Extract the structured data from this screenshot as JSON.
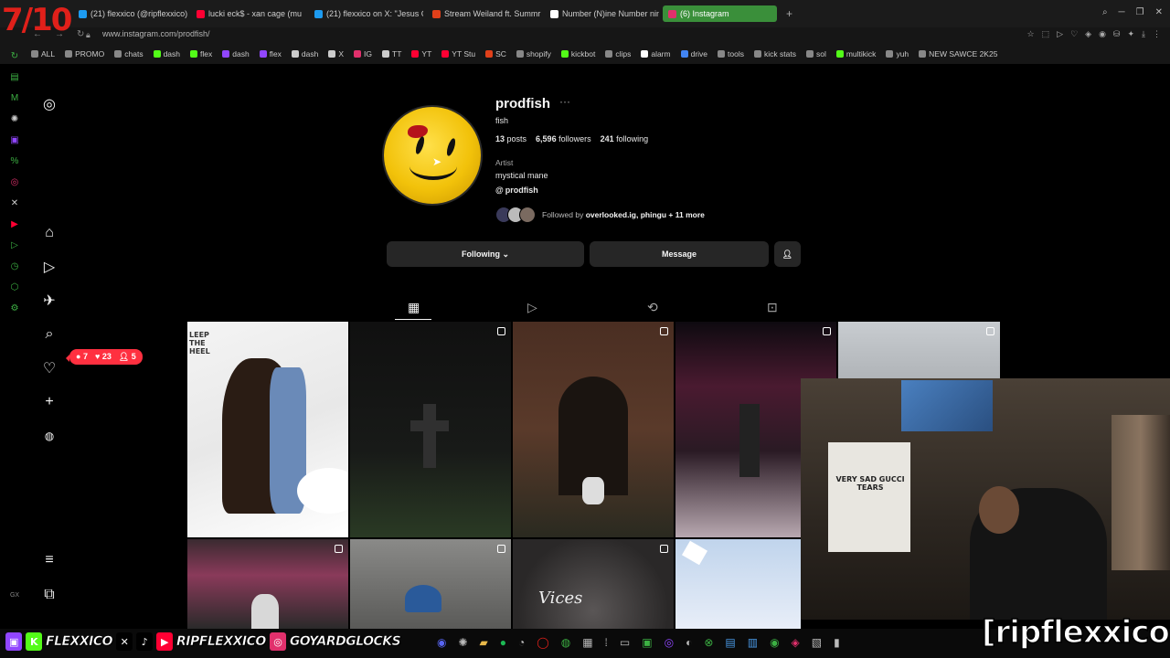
{
  "overlay": {
    "score": "7/10",
    "handle": "[ripflexxico]"
  },
  "browser": {
    "tabs": [
      {
        "title": "(21) flexxico (@ripflexxico)",
        "color": "#1d9bf0",
        "icon": "x-icon"
      },
      {
        "title": "lucki eck$ - xan cage (mu",
        "color": "#ff0033",
        "icon": "youtube-icon"
      },
      {
        "title": "(21) flexxico on X: \"Jesus C",
        "color": "#1d9bf0",
        "icon": "x-icon"
      },
      {
        "title": "Stream Weiland ft. Summr",
        "color": "#e0401a",
        "icon": "soundcloud-icon"
      },
      {
        "title": "Number (N)ine Number nin",
        "color": "#ffffff",
        "icon": "page-icon"
      },
      {
        "title": "(6) Instagram",
        "color": "#e1306c",
        "icon": "instagram-icon"
      }
    ],
    "new_tab": "+",
    "url": "www.instagram.com/prodfish/",
    "bookmarks": [
      {
        "label": "ALL",
        "icon": "folder-icon",
        "color": "#888"
      },
      {
        "label": "PROMO",
        "icon": "folder-icon",
        "color": "#888"
      },
      {
        "label": "chats",
        "icon": "folder-icon",
        "color": "#888"
      },
      {
        "label": "dash",
        "icon": "kick-icon",
        "color": "#53fc18"
      },
      {
        "label": "flex",
        "icon": "kick-icon",
        "color": "#53fc18"
      },
      {
        "label": "dash",
        "icon": "twitch-icon",
        "color": "#9146ff"
      },
      {
        "label": "flex",
        "icon": "twitch-icon",
        "color": "#9146ff"
      },
      {
        "label": "dash",
        "icon": "x-icon",
        "color": "#ccc"
      },
      {
        "label": "X",
        "icon": "x-icon",
        "color": "#ccc"
      },
      {
        "label": "IG",
        "icon": "instagram-icon",
        "color": "#e1306c"
      },
      {
        "label": "TT",
        "icon": "tiktok-icon",
        "color": "#ccc"
      },
      {
        "label": "YT",
        "icon": "youtube-icon",
        "color": "#ff0033"
      },
      {
        "label": "YT Stu",
        "icon": "youtube-icon",
        "color": "#ff0033"
      },
      {
        "label": "SC",
        "icon": "soundcloud-icon",
        "color": "#e0401a"
      },
      {
        "label": "shopify",
        "icon": "folder-icon",
        "color": "#888"
      },
      {
        "label": "kickbot",
        "icon": "bot-icon",
        "color": "#53fc18"
      },
      {
        "label": "clips",
        "icon": "folder-icon",
        "color": "#888"
      },
      {
        "label": "alarm",
        "icon": "alarm-icon",
        "color": "#fff"
      },
      {
        "label": "drive",
        "icon": "google-icon",
        "color": "#4285f4"
      },
      {
        "label": "tools",
        "icon": "folder-icon",
        "color": "#888"
      },
      {
        "label": "kick stats",
        "icon": "folder-icon",
        "color": "#888"
      },
      {
        "label": "sol",
        "icon": "folder-icon",
        "color": "#888"
      },
      {
        "label": "multikick",
        "icon": "kick-icon",
        "color": "#53fc18"
      },
      {
        "label": "yuh",
        "icon": "folder-icon",
        "color": "#888"
      },
      {
        "label": "NEW SAWCE 2K25",
        "icon": "folder-icon",
        "color": "#888"
      }
    ]
  },
  "profile": {
    "username": "prodfish",
    "more": "···",
    "full_name": "fish",
    "stats": {
      "posts": "13",
      "posts_label": "posts",
      "followers": "6,596",
      "followers_label": "followers",
      "following": "241",
      "following_label": "following"
    },
    "category": "Artist",
    "bio": "mystical mane",
    "threads": "prodfish",
    "followed_by_prefix": "Followed by ",
    "followed_by_names": "overlooked.ig, phingu",
    "followed_by_suffix": " + 11 more"
  },
  "actions": {
    "following": "Following",
    "message": "Message"
  },
  "notifications": {
    "comments": "7",
    "likes": "23",
    "follows": "5"
  },
  "grid_overlay_text": {
    "post1_top": "LEEP THE HEEL",
    "post8": "Vices"
  },
  "webcam": {
    "shirt_text": "VERY SAD GUCCI TEARS"
  },
  "social_bar": [
    {
      "icon": "twitch-icon",
      "color": "#9146ff",
      "glyph": "▣"
    },
    {
      "icon": "kick-icon",
      "color": "#53fc18",
      "glyph": "K",
      "label": "FLEXXICO"
    },
    {
      "icon": "x-icon",
      "color": "#000",
      "glyph": "✕"
    },
    {
      "icon": "tiktok-icon",
      "color": "#000",
      "glyph": "♪"
    },
    {
      "icon": "youtube-icon",
      "color": "#ff0033",
      "glyph": "▶",
      "label": "RIPFLEXXICO"
    },
    {
      "icon": "instagram-icon",
      "color": "#e1306c",
      "glyph": "◎",
      "label": "GOYARDGLOCKS"
    }
  ]
}
